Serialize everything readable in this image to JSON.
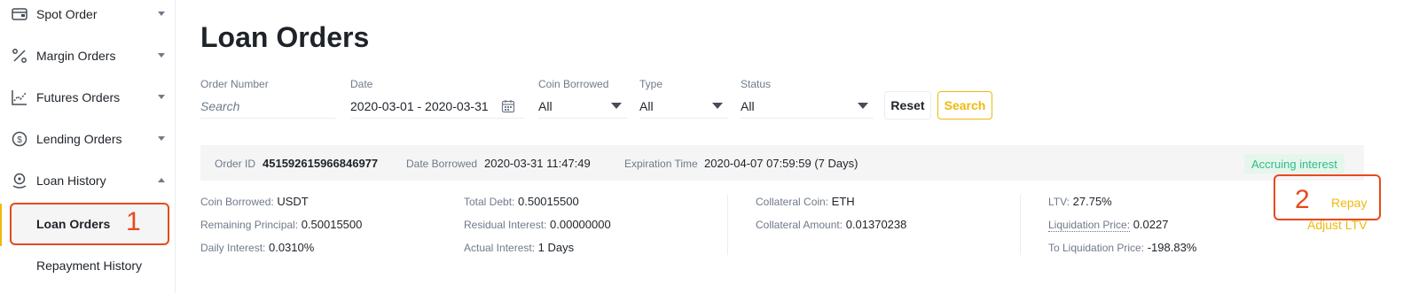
{
  "sidebar": {
    "items": [
      {
        "label": "Spot Order",
        "icon": "wallet-icon"
      },
      {
        "label": "Margin Orders",
        "icon": "percent-icon"
      },
      {
        "label": "Futures Orders",
        "icon": "futures-chart-icon"
      },
      {
        "label": "Lending Orders",
        "icon": "coin-icon"
      },
      {
        "label": "Loan History",
        "icon": "loan-icon"
      }
    ],
    "sub_items": [
      {
        "label": "Loan Orders",
        "active": true
      },
      {
        "label": "Repayment History",
        "active": false
      }
    ],
    "annotation": "1"
  },
  "page": {
    "title": "Loan Orders"
  },
  "filters": {
    "order_number": {
      "label": "Order Number",
      "placeholder": "Search"
    },
    "date": {
      "label": "Date",
      "value": "2020-03-01 - 2020-03-31"
    },
    "coin_borrowed": {
      "label": "Coin Borrowed",
      "value": "All"
    },
    "type": {
      "label": "Type",
      "value": "All"
    },
    "status": {
      "label": "Status",
      "value": "All"
    },
    "reset_label": "Reset",
    "search_label": "Search"
  },
  "order": {
    "order_id_label": "Order ID",
    "order_id": "451592615966846977",
    "date_borrowed_label": "Date Borrowed",
    "date_borrowed": "2020-03-31 11:47:49",
    "expiration_label": "Expiration Time",
    "expiration": "2020-04-07 07:59:59 (7 Days)",
    "status": "Accruing interest",
    "details": {
      "coin_borrowed_label": "Coin Borrowed:",
      "coin_borrowed": "USDT",
      "remaining_principal_label": "Remaining Principal:",
      "remaining_principal": "0.50015500",
      "daily_interest_label": "Daily Interest:",
      "daily_interest": "0.0310%",
      "total_debt_label": "Total Debt:",
      "total_debt": "0.50015500",
      "residual_interest_label": "Residual Interest:",
      "residual_interest": "0.00000000",
      "actual_interest_label": "Actual Interest:",
      "actual_interest": "1 Days",
      "collateral_coin_label": "Collateral Coin:",
      "collateral_coin": "ETH",
      "collateral_amount_label": "Collateral Amount:",
      "collateral_amount": "0.01370238",
      "ltv_label": "LTV:",
      "ltv": "27.75%",
      "liquidation_price_label": "Liquidation Price:",
      "liquidation_price": "0.0227",
      "to_liquidation_label": "To Liquidation Price:",
      "to_liquidation": "-198.83%"
    },
    "actions": {
      "repay": "Repay",
      "adjust_ltv": "Adjust LTV",
      "annotation": "2"
    }
  },
  "colors": {
    "accent": "#f0b90b",
    "annotation": "#e8491d",
    "status": "#2ebd85"
  }
}
